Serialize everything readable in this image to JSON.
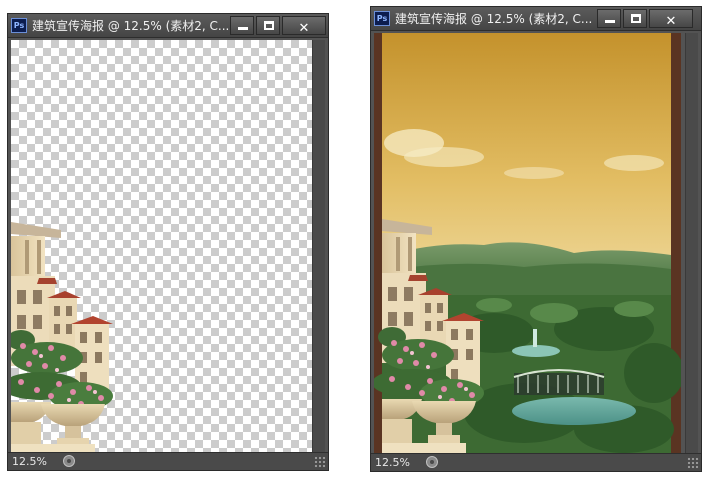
{
  "windows": [
    {
      "title": "建筑宣传海报 @ 12.5% (素材2, C...",
      "zoom": "12.5%",
      "controls": {
        "minimize": "–",
        "maximize": "□",
        "close": "✕"
      },
      "app_icon": "Ps"
    },
    {
      "title": "建筑宣传海报 @ 12.5% (素材2, C...",
      "zoom": "12.5%",
      "controls": {
        "minimize": "–",
        "maximize": "□",
        "close": "✕"
      },
      "app_icon": "Ps"
    }
  ],
  "colors": {
    "panel": "#535353",
    "titlebar": "#4d4d4d",
    "checker_dark": "#cccccc",
    "poster_border": "#5a3422",
    "sky_top": "#c4922c",
    "sky_bottom": "#f6efcf",
    "lake": "#5fa59b"
  },
  "icons": [
    "photoshop-app-icon",
    "minimize-icon",
    "maximize-icon",
    "close-icon",
    "document-info-icon",
    "resize-grip-icon"
  ]
}
